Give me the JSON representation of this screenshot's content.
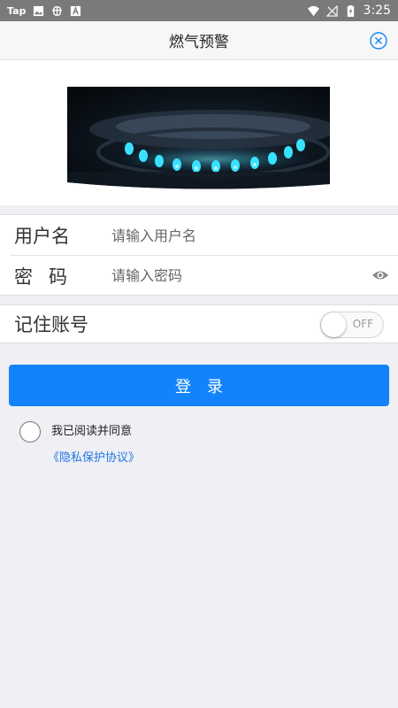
{
  "status_bar": {
    "app_label": "Tap",
    "time": "3:25"
  },
  "header": {
    "title": "燃气预警"
  },
  "form": {
    "username_label": "用户名",
    "username_placeholder": "请输入用户名",
    "password_label": "密码",
    "password_placeholder": "请输入密码"
  },
  "remember": {
    "label": "记住账号",
    "toggle_state": "OFF"
  },
  "login_button": "登录",
  "agreement": {
    "text": "我已阅读并同意",
    "link": "《隐私保护协议》"
  },
  "colors": {
    "accent": "#1283fb",
    "link": "#1d78e6",
    "background": "#efeff4"
  }
}
